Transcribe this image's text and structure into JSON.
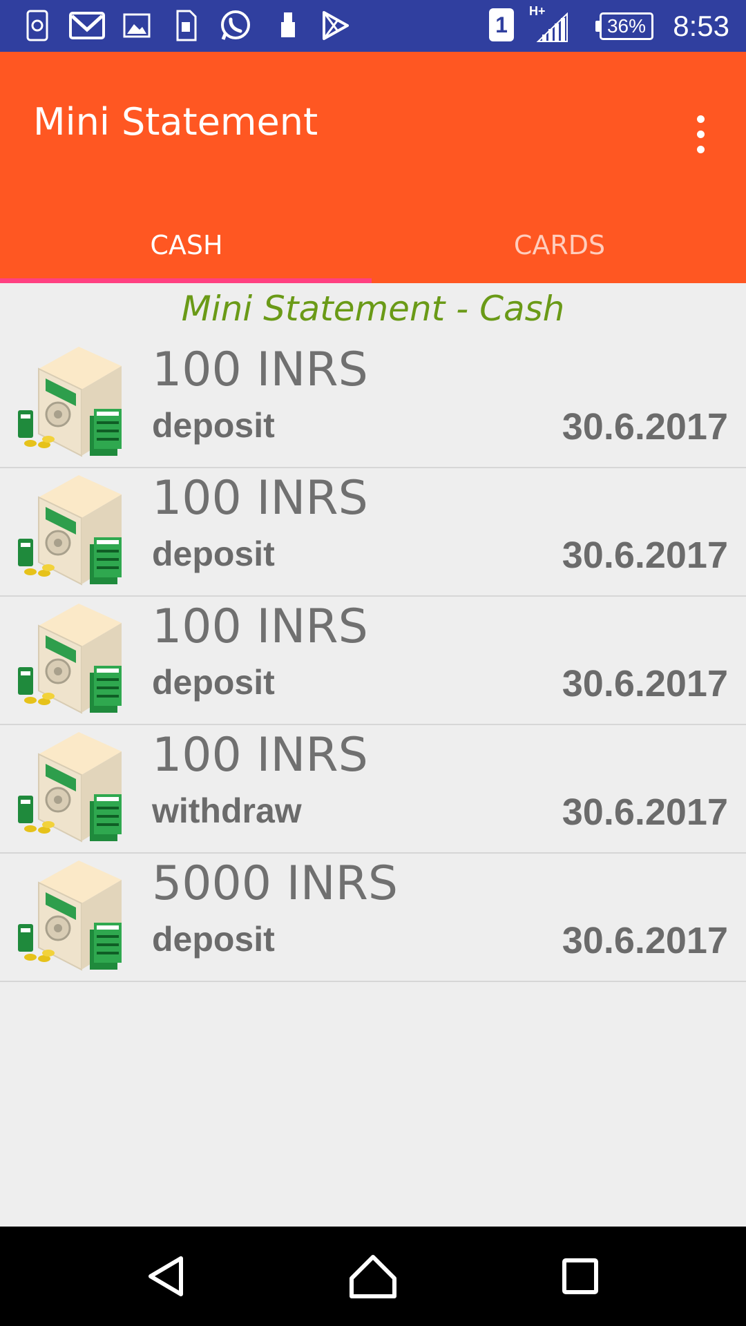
{
  "status_bar": {
    "time": "8:53",
    "battery": "36%",
    "sim_slot": "1",
    "network_type": "H+",
    "notification_icons": [
      "sync-icon",
      "gmail-icon",
      "gallery-icon",
      "sim-toolkit-icon",
      "whatsapp-icon",
      "usb-icon",
      "play-store-icon"
    ],
    "color": "#303f9f"
  },
  "app_bar": {
    "title": "Mini Statement",
    "color": "#ff5722",
    "tabs": [
      {
        "label": "CASH",
        "selected": true
      },
      {
        "label": "CARDS",
        "selected": false
      }
    ],
    "indicator_color": "#ff4081"
  },
  "main": {
    "heading": "Mini Statement - Cash",
    "heading_color": "#6a9a17",
    "transactions": [
      {
        "amount": "100 INRS",
        "type": "deposit",
        "date": "30.6.2017"
      },
      {
        "amount": "100 INRS",
        "type": "deposit",
        "date": "30.6.2017"
      },
      {
        "amount": "100 INRS",
        "type": "deposit",
        "date": "30.6.2017"
      },
      {
        "amount": "100 INRS",
        "type": "withdraw",
        "date": "30.6.2017"
      },
      {
        "amount": "5000 INRS",
        "type": "deposit",
        "date": "30.6.2017"
      }
    ]
  },
  "nav_bar": {
    "buttons": [
      "back-icon",
      "home-icon",
      "recents-icon"
    ]
  }
}
